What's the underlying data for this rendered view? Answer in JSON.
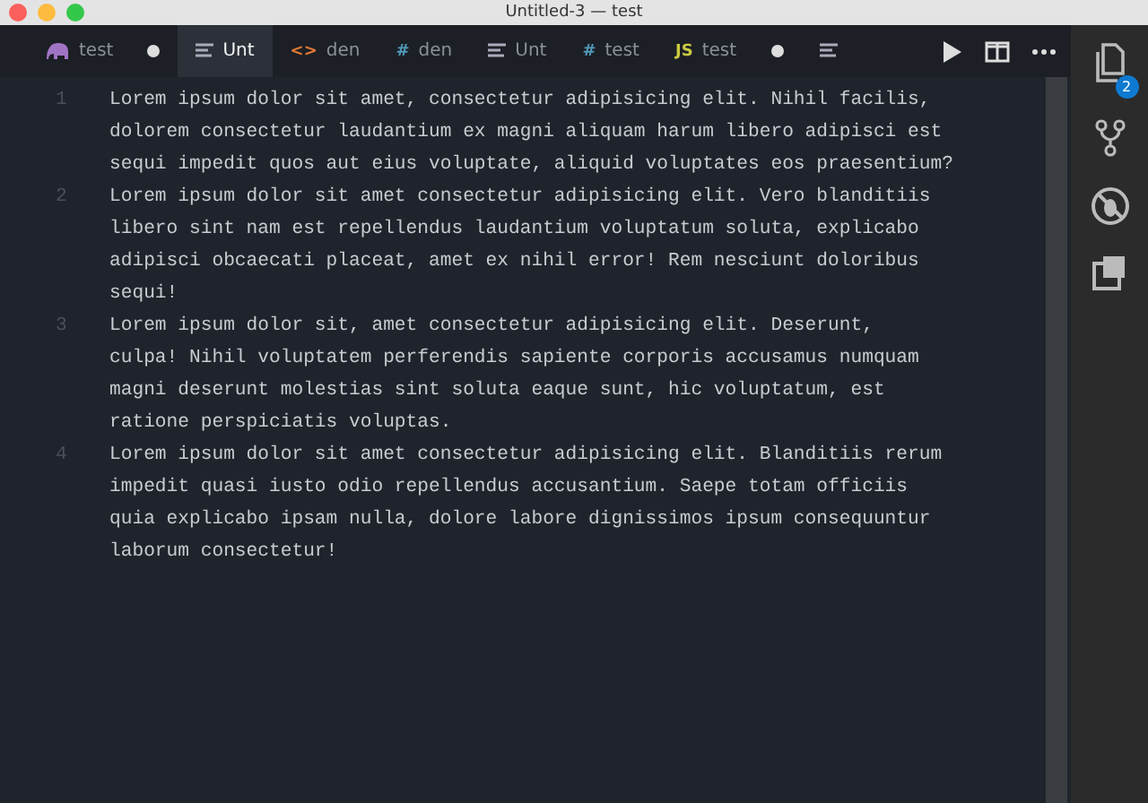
{
  "window": {
    "title": "Untitled-3 — test"
  },
  "tabs": [
    {
      "kind": "elephant",
      "label": "test",
      "selected": false,
      "dirty": true
    },
    {
      "kind": "lines",
      "label": "Unt",
      "selected": true,
      "dirty": false
    },
    {
      "kind": "glyph",
      "icon_text": "<>",
      "color": "#e37933",
      "label": "den",
      "selected": false,
      "dirty": false
    },
    {
      "kind": "glyph",
      "icon_text": "#",
      "color": "#519aba",
      "label": "den",
      "selected": false,
      "dirty": false
    },
    {
      "kind": "lines",
      "label": "Unt",
      "selected": false,
      "dirty": false
    },
    {
      "kind": "glyph",
      "icon_text": "#",
      "color": "#519aba",
      "label": "test",
      "selected": false,
      "dirty": false
    },
    {
      "kind": "glyph",
      "icon_text": "JS",
      "color": "#cbcb41",
      "label": "test",
      "selected": false,
      "dirty": true
    },
    {
      "kind": "lines",
      "selected": false,
      "dirty": false
    }
  ],
  "activity_bar": {
    "explorer_badge": "2"
  },
  "editor": {
    "lines": [
      {
        "number": "1",
        "rows": [
          "Lorem ipsum dolor sit amet, consectetur adipisicing elit. Nihil facilis,",
          "dolorem consectetur laudantium ex magni aliquam harum libero adipisci est",
          "sequi impedit quos aut eius voluptate, aliquid voluptates eos praesentium?"
        ]
      },
      {
        "number": "2",
        "rows": [
          "Lorem ipsum dolor sit amet consectetur adipisicing elit. Vero blanditiis",
          "libero sint nam est repellendus laudantium voluptatum soluta, explicabo",
          "adipisci obcaecati placeat, amet ex nihil error! Rem nesciunt doloribus",
          "sequi!"
        ]
      },
      {
        "number": "3",
        "rows": [
          "Lorem ipsum dolor sit, amet consectetur adipisicing elit. Deserunt,",
          "culpa! Nihil voluptatem perferendis sapiente corporis accusamus numquam",
          "magni deserunt molestias sint soluta eaque sunt, hic voluptatum, est",
          "ratione perspiciatis voluptas."
        ]
      },
      {
        "number": "4",
        "rows": [
          "Lorem ipsum dolor sit amet consectetur adipisicing elit. Blanditiis rerum",
          "impedit quasi iusto odio repellendus accusantium. Saepe totam officiis",
          "quia explicabo ipsam nulla, dolore labore dignissimos ipsum consequuntur",
          "laborum consectetur!"
        ]
      }
    ]
  }
}
